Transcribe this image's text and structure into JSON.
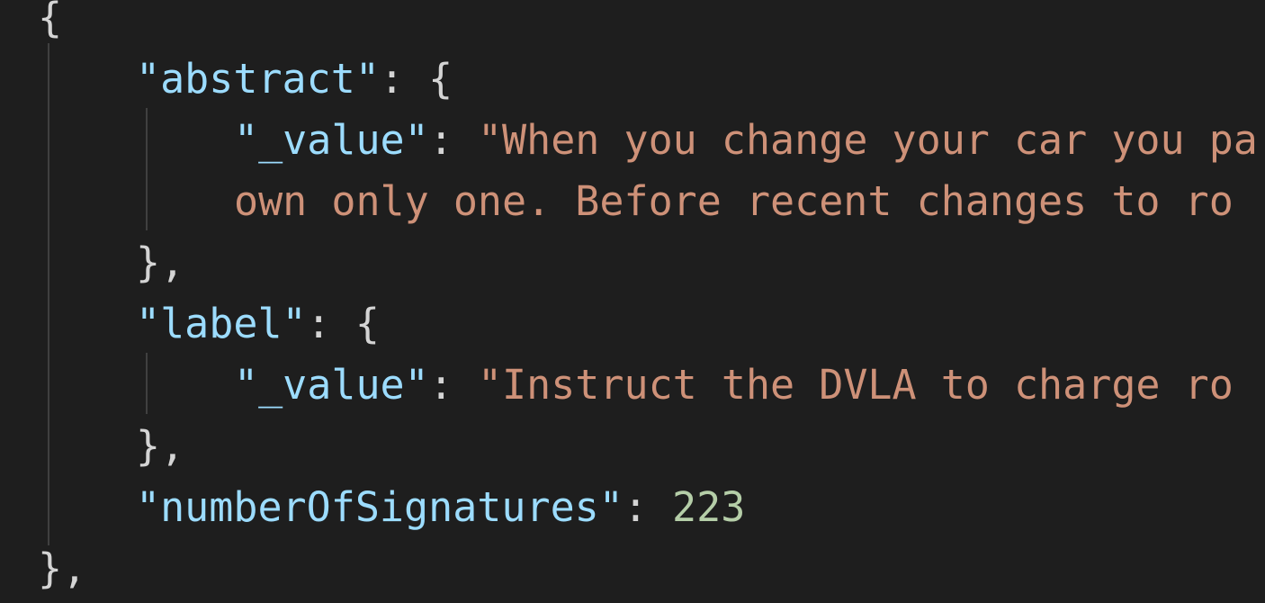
{
  "editor": {
    "theme_colors": {
      "background": "#1e1e1e",
      "key": "#9cdcfe",
      "string": "#ce9178",
      "number": "#b5cea8",
      "punctuation": "#d4d4d4"
    },
    "lines": {
      "open_brace": "{",
      "abstract_key": "\"abstract\"",
      "abstract_value_key": "\"_value\"",
      "abstract_value_line1": "\"When you change your car you pa",
      "abstract_value_line2": "own only one. Before recent changes to ro",
      "close1": "},",
      "label_key": "\"label\"",
      "label_value_key": "\"_value\"",
      "label_value": "\"Instruct the DVLA to charge ro",
      "close2": "},",
      "signatures_key": "\"numberOfSignatures\"",
      "signatures_value": "223",
      "close3": "},"
    },
    "punct": {
      "colon": ": ",
      "brace": "{"
    }
  }
}
